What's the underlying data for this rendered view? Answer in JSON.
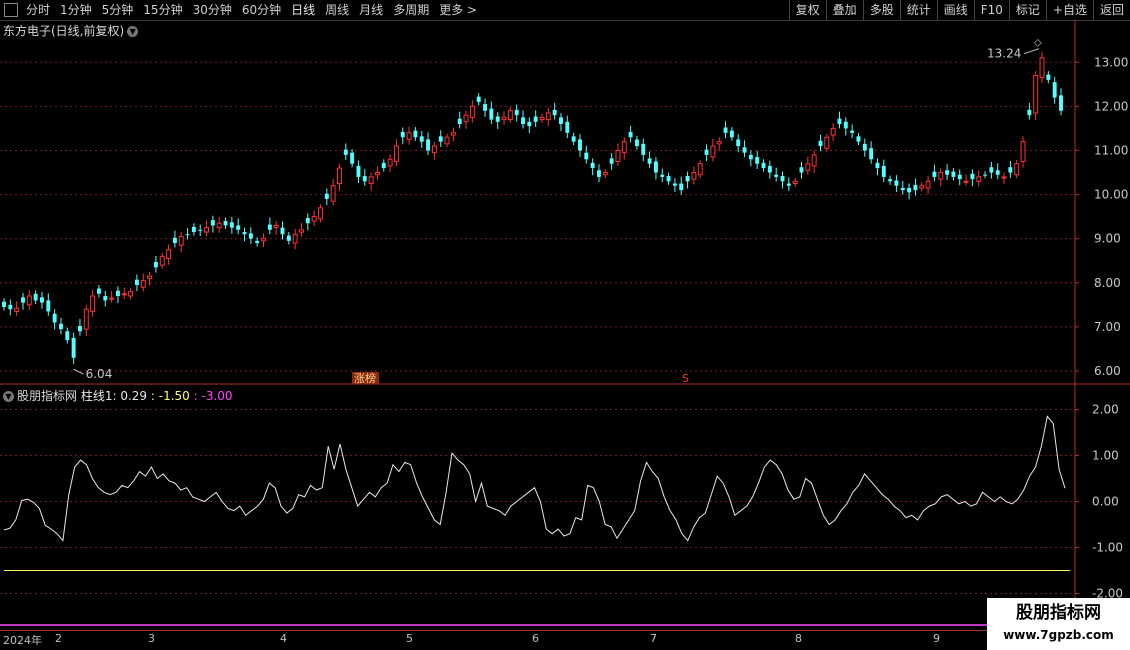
{
  "toolbar": {
    "periods": [
      "分时",
      "1分钟",
      "5分钟",
      "15分钟",
      "30分钟",
      "60分钟",
      "日线",
      "周线",
      "月线",
      "多周期",
      "更多 >"
    ],
    "right": [
      "复权",
      "叠加",
      "多股",
      "统计",
      "画线",
      "F10",
      "标记",
      "+自选",
      "返回"
    ]
  },
  "chart_title": "东方电子(日线,前复权)",
  "indicator": {
    "name": "股朋指标网",
    "label_a": "柱线1: 0.29",
    "label_b": ": -1.50",
    "label_c": ": -3.00",
    "color_a": "#e8e8e8",
    "color_b": "#ffff66",
    "color_c": "#ff44ff"
  },
  "markers": {
    "high": "13.24",
    "low": "6.04",
    "zhangbang": "涨榜",
    "s": "S"
  },
  "colors": {
    "up": "#ff3232",
    "down": "#54ffff",
    "grid": "#7a1e1e",
    "axis": "#b03030"
  },
  "dates": {
    "year": "2024年",
    "months": [
      "2",
      "3",
      "4",
      "5",
      "6",
      "7",
      "8",
      "9"
    ]
  },
  "watermark": {
    "title": "股朋指标网",
    "url": "www.7gpzb.com"
  },
  "chart_data": [
    {
      "type": "candlestick",
      "yticks": [
        "13.00",
        "12.00",
        "11.00",
        "10.00",
        "9.00",
        "8.00",
        "7.00",
        "6.00"
      ],
      "ylim": [
        5.75,
        13.55
      ],
      "high_label": 13.24,
      "low_label": 6.04,
      "close": [
        7.45,
        7.4,
        7.42,
        7.55,
        7.7,
        7.6,
        7.55,
        7.35,
        7.1,
        6.95,
        6.7,
        6.3,
        6.9,
        7.4,
        7.7,
        7.75,
        7.6,
        7.65,
        7.7,
        7.75,
        7.8,
        7.95,
        8.05,
        8.15,
        8.35,
        8.6,
        8.75,
        8.9,
        9.05,
        9.1,
        9.15,
        9.2,
        9.25,
        9.3,
        9.35,
        9.3,
        9.25,
        9.2,
        9.1,
        9.0,
        8.9,
        9.0,
        9.2,
        9.3,
        9.1,
        8.95,
        9.1,
        9.2,
        9.35,
        9.5,
        9.7,
        9.9,
        10.2,
        10.6,
        10.9,
        10.7,
        10.4,
        10.3,
        10.4,
        10.5,
        10.6,
        10.8,
        11.1,
        11.3,
        11.4,
        11.3,
        11.2,
        11.0,
        11.1,
        11.2,
        11.3,
        11.4,
        11.6,
        11.8,
        12.0,
        12.1,
        11.9,
        11.7,
        11.65,
        11.75,
        11.9,
        11.8,
        11.6,
        11.55,
        11.65,
        11.75,
        11.85,
        11.8,
        11.6,
        11.4,
        11.2,
        11.0,
        10.8,
        10.6,
        10.4,
        10.5,
        10.7,
        11.0,
        11.2,
        11.3,
        11.1,
        10.9,
        10.7,
        10.5,
        10.4,
        10.3,
        10.2,
        10.1,
        10.3,
        10.5,
        10.7,
        10.9,
        11.1,
        11.2,
        11.4,
        11.3,
        11.1,
        10.95,
        10.8,
        10.7,
        10.6,
        10.5,
        10.4,
        10.3,
        10.2,
        10.3,
        10.5,
        10.7,
        10.9,
        11.1,
        11.3,
        11.5,
        11.6,
        11.5,
        11.4,
        11.2,
        11.0,
        10.8,
        10.6,
        10.4,
        10.3,
        10.2,
        10.1,
        10.05,
        10.1,
        10.2,
        10.3,
        10.4,
        10.5,
        10.45,
        10.4,
        10.35,
        10.3,
        10.35,
        10.4,
        10.45,
        10.5,
        10.45,
        10.4,
        10.5,
        10.7,
        11.2,
        11.8,
        12.7,
        13.1,
        12.6,
        12.2,
        11.9
      ]
    },
    {
      "type": "line",
      "yticks": [
        "2.00",
        "1.00",
        "0.00",
        "-1.00",
        "-2.00"
      ],
      "ylim": [
        -2.25,
        2.25
      ],
      "series": [
        {
          "values": [
            -0.62,
            -0.58,
            -0.4,
            0.02,
            0.05,
            -0.02,
            -0.15,
            -0.52,
            -0.6,
            -0.7,
            -0.85,
            0.15,
            0.75,
            0.9,
            0.8,
            0.5,
            0.3,
            0.2,
            0.15,
            0.2,
            0.35,
            0.3,
            0.45,
            0.65,
            0.55,
            0.75,
            0.5,
            0.6,
            0.45,
            0.4,
            0.25,
            0.3,
            0.1,
            0.05,
            0.0,
            0.1,
            0.2,
            0.0,
            -0.15,
            -0.2,
            -0.1,
            -0.3,
            -0.2,
            -0.1,
            0.05,
            0.4,
            0.3,
            -0.1,
            -0.25,
            -0.15,
            0.15,
            0.1,
            0.35,
            0.25,
            0.3,
            1.2,
            0.7,
            1.25,
            0.7,
            0.3,
            -0.1,
            0.05,
            0.2,
            0.1,
            0.3,
            0.4,
            0.8,
            0.65,
            0.85,
            0.8,
            0.4,
            0.1,
            -0.15,
            -0.4,
            -0.5,
            0.2,
            1.05,
            0.9,
            0.8,
            0.6,
            0.0,
            0.4,
            -0.1,
            -0.15,
            -0.2,
            -0.3,
            -0.1,
            0.0,
            0.1,
            0.2,
            0.3,
            0.0,
            -0.6,
            -0.7,
            -0.6,
            -0.75,
            -0.7,
            -0.35,
            -0.4,
            0.35,
            0.3,
            0.0,
            -0.5,
            -0.55,
            -0.8,
            -0.6,
            -0.4,
            -0.2,
            0.45,
            0.85,
            0.65,
            0.5,
            0.1,
            -0.2,
            -0.4,
            -0.7,
            -0.85,
            -0.55,
            -0.35,
            -0.25,
            0.15,
            0.55,
            0.4,
            0.1,
            -0.3,
            -0.2,
            -0.1,
            0.1,
            0.4,
            0.75,
            0.9,
            0.8,
            0.6,
            0.25,
            0.05,
            0.1,
            0.5,
            0.4,
            0.05,
            -0.3,
            -0.5,
            -0.4,
            -0.2,
            -0.05,
            0.2,
            0.35,
            0.6,
            0.45,
            0.3,
            0.15,
            0.05,
            -0.1,
            -0.2,
            -0.35,
            -0.3,
            -0.4,
            -0.2,
            -0.1,
            -0.05,
            0.1,
            0.15,
            0.05,
            -0.05,
            0.0,
            -0.1,
            -0.05,
            0.2,
            0.1,
            0.0,
            0.1,
            0.0,
            -0.05,
            0.05,
            0.25,
            0.55,
            0.75,
            1.2,
            1.85,
            1.7,
            0.7,
            0.29
          ]
        },
        {
          "values": [
            -1.5
          ]
        },
        {
          "values": [
            -3.0
          ]
        }
      ]
    }
  ]
}
